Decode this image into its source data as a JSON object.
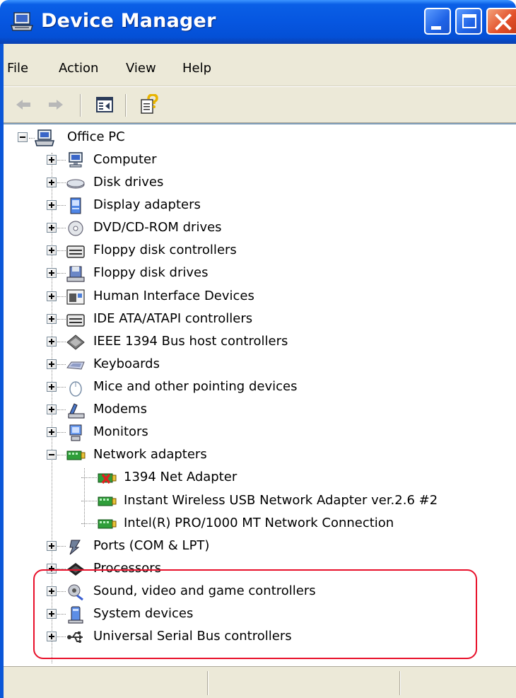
{
  "window": {
    "title": "Device Manager"
  },
  "menu": [
    "File",
    "Action",
    "View",
    "Help"
  ],
  "toolbar": {
    "buttons": [
      "back-arrow-icon",
      "forward-arrow-icon",
      "show-hide-console-tree-icon",
      "help-properties-icon"
    ]
  },
  "tree": {
    "root": "Office PC",
    "categories": [
      {
        "label": "Computer",
        "icon": "computer-icon"
      },
      {
        "label": "Disk drives",
        "icon": "disk-drive-icon"
      },
      {
        "label": "Display adapters",
        "icon": "display-adapter-icon"
      },
      {
        "label": "DVD/CD-ROM drives",
        "icon": "dvd-drive-icon"
      },
      {
        "label": "Floppy disk controllers",
        "icon": "controller-icon"
      },
      {
        "label": "Floppy disk drives",
        "icon": "floppy-drive-icon"
      },
      {
        "label": "Human Interface Devices",
        "icon": "hid-icon"
      },
      {
        "label": "IDE ATA/ATAPI controllers",
        "icon": "controller-icon"
      },
      {
        "label": "IEEE 1394 Bus host controllers",
        "icon": "ieee1394-icon"
      },
      {
        "label": "Keyboards",
        "icon": "keyboard-icon"
      },
      {
        "label": "Mice and other pointing devices",
        "icon": "mouse-icon"
      },
      {
        "label": "Modems",
        "icon": "modem-icon"
      },
      {
        "label": "Monitors",
        "icon": "monitor-icon"
      },
      {
        "label": "Network adapters",
        "icon": "network-adapter-icon",
        "expanded": true,
        "children": [
          {
            "label": "1394 Net Adapter",
            "icon": "network-adapter-disabled-icon"
          },
          {
            "label": "Instant Wireless USB Network Adapter ver.2.6 #2",
            "icon": "network-adapter-icon"
          },
          {
            "label": "Intel(R) PRO/1000 MT Network Connection",
            "icon": "network-adapter-icon"
          }
        ]
      },
      {
        "label": "Ports (COM & LPT)",
        "icon": "port-icon"
      },
      {
        "label": "Processors",
        "icon": "processor-icon"
      },
      {
        "label": "Sound, video and game controllers",
        "icon": "sound-icon"
      },
      {
        "label": "System devices",
        "icon": "system-device-icon"
      },
      {
        "label": "Universal Serial Bus controllers",
        "icon": "usb-icon"
      }
    ]
  },
  "colors": {
    "titlebar": "#0656e0",
    "highlight": "#e8102a",
    "chrome": "#ece9d8"
  }
}
